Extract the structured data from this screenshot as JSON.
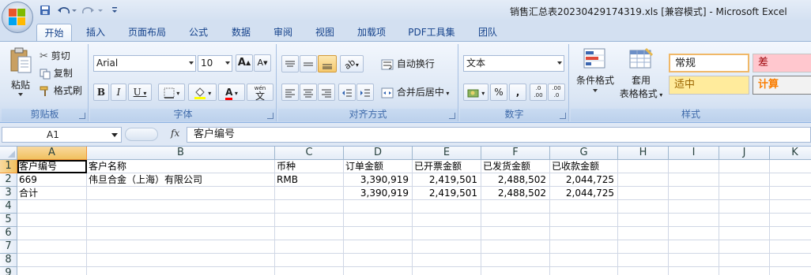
{
  "window": {
    "title": "销售汇总表20230429174319.xls  [兼容模式] - Microsoft Excel"
  },
  "qat": {
    "save_icon": "save-icon",
    "undo_icon": "undo-icon",
    "redo_icon": "redo-icon"
  },
  "tabs": [
    {
      "label": "开始",
      "active": true
    },
    {
      "label": "插入"
    },
    {
      "label": "页面布局"
    },
    {
      "label": "公式"
    },
    {
      "label": "数据"
    },
    {
      "label": "审阅"
    },
    {
      "label": "视图"
    },
    {
      "label": "加载项"
    },
    {
      "label": "PDF工具集"
    },
    {
      "label": "团队"
    }
  ],
  "ribbon": {
    "clipboard": {
      "label": "剪贴板",
      "paste": "粘贴",
      "cut": "剪切",
      "copy": "复制",
      "format_painter": "格式刷"
    },
    "font": {
      "label": "字体",
      "family": "Arial",
      "size": "10",
      "grow": "A",
      "shrink": "A",
      "bold": "B",
      "italic": "I",
      "underline": "U",
      "font_color_letter": "A",
      "phonetic": "文",
      "phonetic_top": "wén"
    },
    "alignment": {
      "label": "对齐方式",
      "wrap": "自动换行",
      "merge": "合并后居中"
    },
    "number": {
      "label": "数字",
      "format": "文本",
      "percent": "%",
      "comma": ",",
      "inc_decimal": ".0 .00",
      "dec_decimal": ".00 .0"
    },
    "styles": {
      "label": "样式",
      "conditional": "条件格式",
      "table_format_1": "套用",
      "table_format_2": "表格格式",
      "normal": "常规",
      "bad": "差",
      "neutral": "适中",
      "calc": "计算"
    }
  },
  "formula_bar": {
    "name_box": "A1",
    "fx": "fx",
    "content": "客户编号"
  },
  "sheet": {
    "columns": [
      "A",
      "B",
      "C",
      "D",
      "E",
      "F",
      "G",
      "H",
      "I",
      "J",
      "K"
    ],
    "row_numbers": [
      "1",
      "2",
      "3",
      "4",
      "5",
      "6",
      "7",
      "8",
      "9"
    ],
    "rows": [
      [
        "客户编号",
        "客户名称",
        "币种",
        "订单金额",
        "已开票金额",
        "已发货金额",
        "已收款金额"
      ],
      [
        "669",
        "伟旦合金（上海）有限公司",
        "RMB",
        "3,390,919",
        "2,419,501",
        "2,488,502",
        "2,044,725"
      ],
      [
        "合计",
        "",
        "",
        "3,390,919",
        "2,419,501",
        "2,488,502",
        "2,044,725"
      ]
    ]
  }
}
